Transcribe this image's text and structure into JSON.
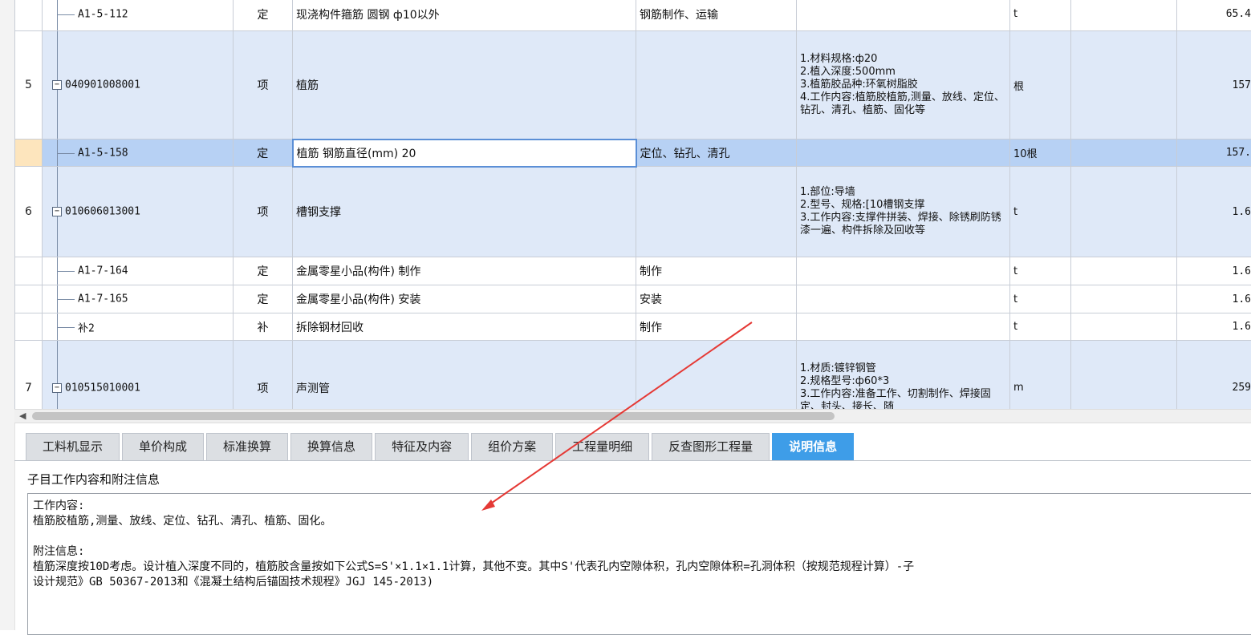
{
  "rows": [
    {
      "num": "",
      "code": "A1-5-112",
      "type": "定",
      "name": "现浇构件箍筋 圆钢 ф10以外",
      "content": "钢筋制作、运输",
      "features": "",
      "unit": "t",
      "qty": "65.4"
    },
    {
      "num": "5",
      "code": "040901008001",
      "type": "项",
      "name": "植筋",
      "content": "",
      "features": "1.材料规格:ф20\n2.植入深度:500mm\n3.植筋胶品种:环氧树脂胶\n4.工作内容:植筋胶植筋,测量、放线、定位、钻孔、清孔、植筋、固化等",
      "unit": "根",
      "qty": "157"
    },
    {
      "num": "",
      "code": "A1-5-158",
      "type": "定",
      "name": "植筋 钢筋直径(mm) 20",
      "content": "定位、钻孔、清孔",
      "features": "",
      "unit": "10根",
      "qty": "157."
    },
    {
      "num": "6",
      "code": "010606013001",
      "type": "项",
      "name": "槽钢支撑",
      "content": "",
      "features": "1.部位:导墙\n2.型号、规格:[10槽钢支撑\n3.工作内容:支撑件拼装、焊接、除锈刷防锈漆一遍、构件拆除及回收等",
      "unit": "t",
      "qty": "1.6"
    },
    {
      "num": "",
      "code": "A1-7-164",
      "type": "定",
      "name": "金属零星小品(构件) 制作",
      "content": "制作",
      "features": "",
      "unit": "t",
      "qty": "1.6"
    },
    {
      "num": "",
      "code": "A1-7-165",
      "type": "定",
      "name": "金属零星小品(构件) 安装",
      "content": "安装",
      "features": "",
      "unit": "t",
      "qty": "1.6"
    },
    {
      "num": "",
      "code": "补2",
      "type": "补",
      "name": "拆除钢材回收",
      "content": "制作",
      "features": "",
      "unit": "t",
      "qty": "1.6"
    },
    {
      "num": "7",
      "code": "010515010001",
      "type": "项",
      "name": "声测管",
      "content": "",
      "features": "1.材质:镀锌钢管\n2.规格型号:ф60*3\n3.工作内容:准备工作、切割制作、焊接固定、封头、接长、随",
      "unit": "m",
      "qty": "259"
    }
  ],
  "tabs": [
    "工料机显示",
    "单价构成",
    "标准换算",
    "换算信息",
    "特征及内容",
    "组价方案",
    "工程量明细",
    "反查图形工程量",
    "说明信息"
  ],
  "panel": {
    "title": "子目工作内容和附注信息",
    "content": "工作内容:\n植筋胶植筋,测量、放线、定位、钻孔、清孔、植筋、固化。\n\n附注信息:\n植筋深度按10D考虑。设计植入深度不同的，植筋胶含量按如下公式S=S'×1.1×1.1计算，其他不变。其中S'代表孔内空隙体积，孔内空隙体积=孔洞体积（按规范规程计算）-子\n设计规范》GB 50367-2013和《混凝土结构后锚固技术规程》JGJ 145-2013)"
  },
  "colors": {
    "active_tab": "#3e9de8",
    "parent_row": "#dfe9f8",
    "selected_row": "#b7d1f4",
    "arrow": "#e53935"
  }
}
